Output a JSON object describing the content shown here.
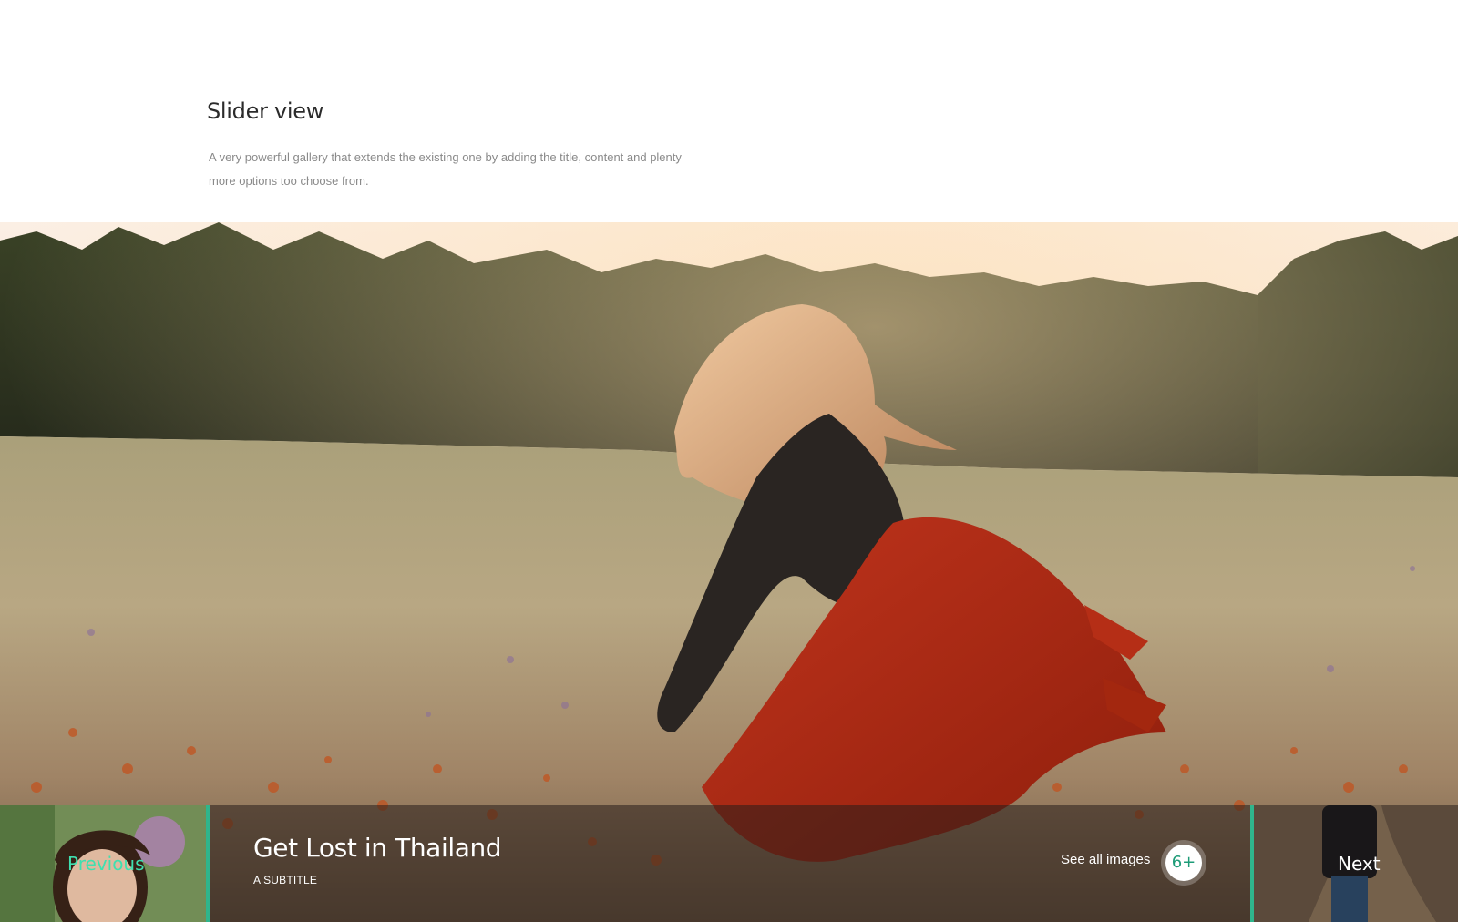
{
  "section": {
    "title": "Slider view",
    "description": "A very powerful gallery that extends the existing one by adding the title, content and plenty more options too choose from."
  },
  "slide": {
    "image": "woman-in-red-dress-in-meadow",
    "title": "Get Lost in Thailand",
    "subtitle": "A SUBTITLE"
  },
  "controls": {
    "previous_label": "Previous",
    "next_label": "Next",
    "see_all_label": "See all images",
    "more_count": "6+"
  },
  "colors": {
    "accent": "#2fb58c",
    "accent_text": "#3fe0b0",
    "title_text": "#2b2b2b",
    "body_text": "#8a8a8a"
  }
}
